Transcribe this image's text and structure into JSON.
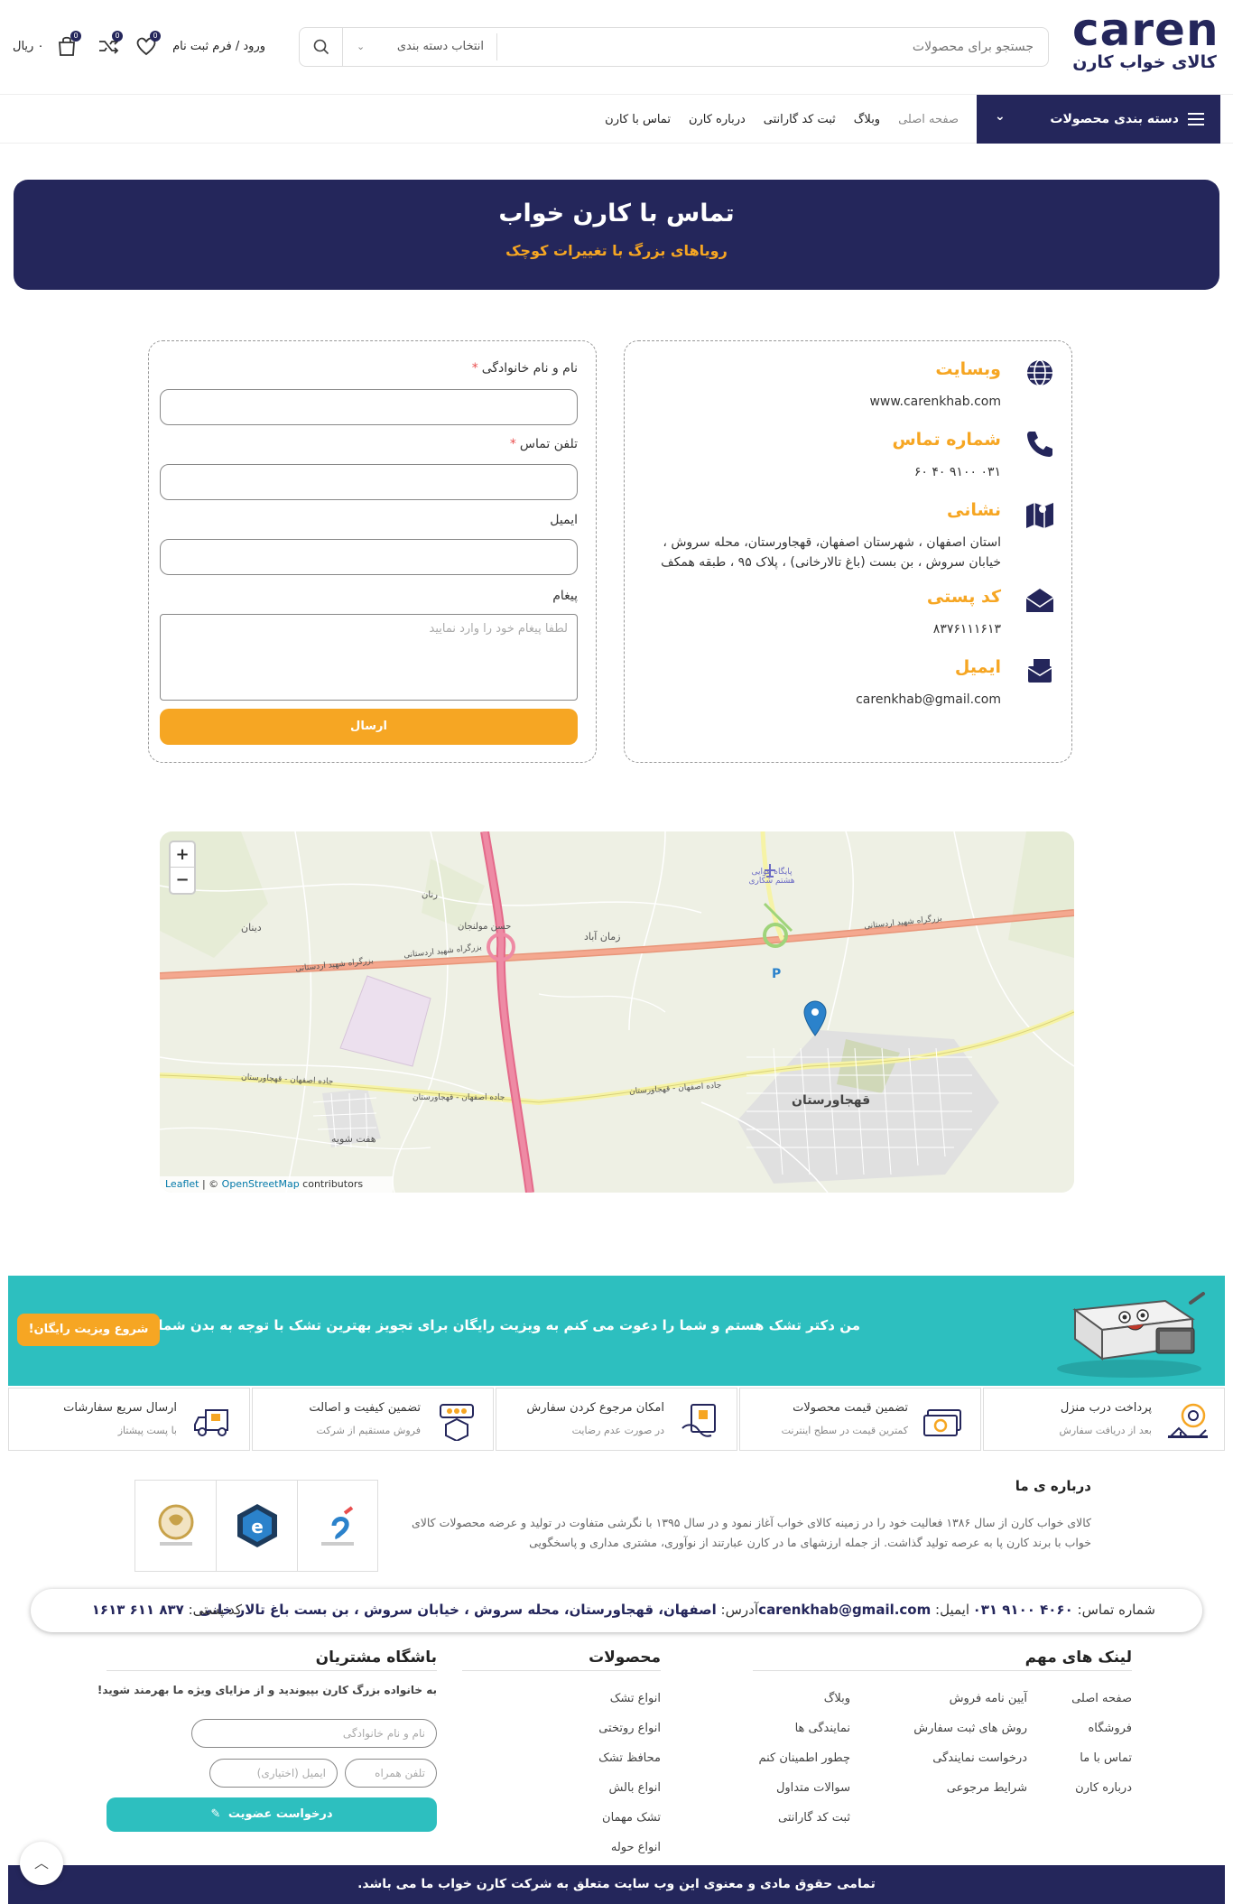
{
  "header": {
    "logo_word": "caren",
    "logo_subtitle": "کالای خواب کارن",
    "search_placeholder": "جستجو برای محصولات",
    "category_select": "انتخاب دسته بندی",
    "login_label": "ورود / فرم ثبت نام",
    "wishlist_count": "0",
    "compare_count": "0",
    "cart_count": "0",
    "cart_total": "۰ ریال"
  },
  "nav": {
    "categories_button": "دسته بندی محصولات",
    "links": [
      "صفحه اصلی",
      "وبلاگ",
      "ثبت کد گارانتی",
      "درباره کارن",
      "تماس با کارن"
    ]
  },
  "hero": {
    "title": "تماس با کارن خواب",
    "subtitle": "رویاهای بزرگ با تغییرات کوچک"
  },
  "contact_info": {
    "website_title": "وبسایت",
    "website_value": "www.carenkhab.com",
    "phone_title": "شماره تماس",
    "phone_value": "۰۳۱ ۹۱۰۰ ۴۰ ۶۰",
    "address_title": "نشانی",
    "address_value": "استان اصفهان ، شهرستان اصفهان، قهجاورستان، محله سروش ، خیابان سروش ، بن بست (باغ تالارخانی) ، پلاک ۹۵ ، طبقه همکف",
    "postal_title": "کد پستی",
    "postal_value": "۸۳۷۶۱۱۱۶۱۳",
    "email_title": "ایمیل",
    "email_value": "carenkhab@gmail.com"
  },
  "form": {
    "name_label": "نام و نام خانوادگی",
    "phone_label": "تلفن تماس",
    "email_label": "ایمیل",
    "message_label": "پیغام",
    "message_placeholder": "لطفا پیغام خود را وارد نمایید",
    "required_mark": "*",
    "submit_label": "ارسال"
  },
  "map": {
    "zoom_in": "+",
    "zoom_out": "−",
    "attribution_leaflet": "Leaflet",
    "attribution_sep": " | © ",
    "attribution_osm": "OpenStreetMap",
    "attribution_tail": " contributors",
    "labels": {
      "highway1": "بزرگراه شهید اردستانی",
      "highway2": "بزرگراه شهید اردستانی",
      "highway3": "بزرگراه شهید اردستانی",
      "road1": "جاده اصفهان - قهجاورستان",
      "road2": "جاده اصفهان - قهجاورستان",
      "road3": "جاده اصفهان - قهجاورستان",
      "town": "قهجاورستان",
      "airbase": "پایگاه هوایی هشتم شکاری",
      "zaman": "زمان آباد",
      "mollujan": "حسن مولنجان",
      "haft_shuyeh": "هفت شویه",
      "dinan": "دینان",
      "vezvan": "رنان",
      "parking": "P"
    }
  },
  "promo": {
    "text": "من دکتر تشک هستم و شما را دعوت می کنم به ویزیت رایگان برای تجویز بهترین تشک با توجه به بدن شما!",
    "button": "شروع ویزیت رایگان!"
  },
  "features": [
    {
      "title": "پرداخت درب منزل",
      "sub": "بعد از دریافت سفارش"
    },
    {
      "title": "تضمین قیمت محصولات",
      "sub": "کمترین قیمت در سطح اینترنت"
    },
    {
      "title": "امکان مرجوع کردن سفارش",
      "sub": "در صورت عدم رضایت"
    },
    {
      "title": "تضمین کیفیت و اصالت",
      "sub": "فروش مستقیم از شرکت"
    },
    {
      "title": "ارسال سریع سفارشات",
      "sub": "با پست پیشتاز"
    }
  ],
  "about": {
    "title": "درباره ی ما",
    "text": "کالای خواب کارن از سال ۱۳۸۶ فعالیت خود را در زمینه کالای خواب آغاز نمود و در سال ۱۳۹۵ با نگرشی متفاوت در تولید و عرضه محصولات کالای خواب با برند کارن پا به عرصه تولید گذاشت. از جمله ارزشهای ما در کارن عبارتند از نوآوری، مشتری مداری و پاسخگویی"
  },
  "contact_strip": {
    "phone_label": "شماره تماس:",
    "phone_value": "۴۰۶۰ ۹۱۰۰ ۰۳۱",
    "email_label": "ایمیل:",
    "email_value": "carenkhab@gmail.com",
    "address_label": "آدرس:",
    "address_value": "اصفهان، قهجاورستان، محله سروش ، خیابان سروش ، بن بست باغ تالار خانی",
    "postal_label": "کد پستی:",
    "postal_value": "۸۳۷ ۶۱۱ ۱۶۱۳"
  },
  "footer": {
    "links_title": "لینک های مهم",
    "links_col1": [
      "صفحه اصلی",
      "فروشگاه",
      "تماس با ما",
      "درباره کارن"
    ],
    "links_col2": [
      "آیین نامه فروش",
      "روش های ثبت سفارش",
      "درخواست نمایندگی",
      "شرایط مرجوعی"
    ],
    "links_col3": [
      "وبلاگ",
      "نمایندگی ها",
      "چطور اطمینان کنم",
      "سوالات متداول",
      "ثبت کد گارانتی"
    ],
    "products_title": "محصولات",
    "products": [
      "انواع تشک",
      "انواع روتختی",
      "محافظ تشک",
      "انواع بالش",
      "تشک مهمان",
      "انواع حوله"
    ],
    "club_title": "باشگاه مشتریان",
    "club_text": "به خانواده بزرگ کارن بپیوندید و از مزایای ویژه ما بهرمند شوید!",
    "club_name_placeholder": "نام و نام خانوادگی",
    "club_phone_placeholder": "تلفن همراه",
    "club_email_placeholder": "ایمیل (اختیاری)",
    "club_button": "درخواست عضویت"
  },
  "copyright": "تمامی حقوق مادی و معنوی این وب سایت متعلق به شرکت کارن خواب ما می باشد.",
  "colors": {
    "navy": "#24265b",
    "orange": "#f6a623",
    "teal": "#2dbfbf"
  }
}
